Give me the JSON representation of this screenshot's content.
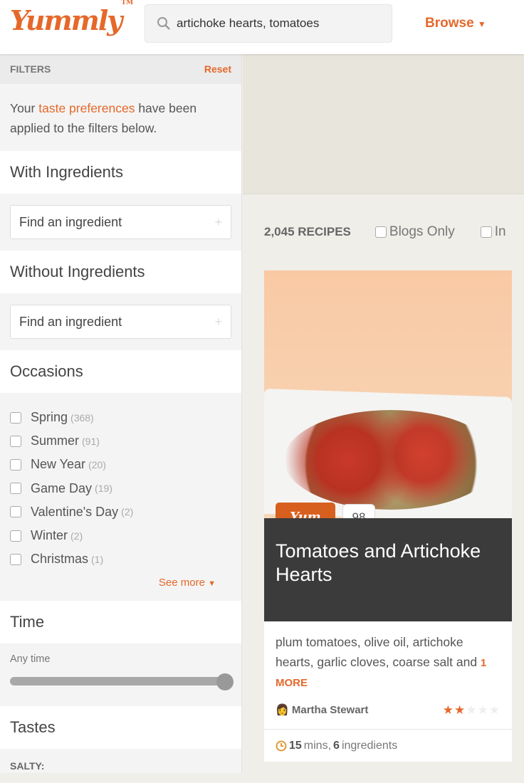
{
  "header": {
    "logo": "Yummly",
    "logo_tm": "TM",
    "search_value": "artichoke hearts, tomatoes",
    "browse": "Browse"
  },
  "sidebar": {
    "filters_label": "FILTERS",
    "reset": "Reset",
    "taste_pre": "Your ",
    "taste_link": "taste preferences",
    "taste_post": " have been applied to the filters below.",
    "with_ingredients": "With Ingredients",
    "with_placeholder": "Find an ingredient",
    "without_ingredients": "Without Ingredients",
    "without_placeholder": "Find an ingredient",
    "occasions": "Occasions",
    "occasion_items": [
      {
        "label": "Spring",
        "count": "(368)"
      },
      {
        "label": "Summer",
        "count": "(91)"
      },
      {
        "label": "New Year",
        "count": "(20)"
      },
      {
        "label": "Game Day",
        "count": "(19)"
      },
      {
        "label": "Valentine's Day",
        "count": "(2)"
      },
      {
        "label": "Winter",
        "count": "(2)"
      },
      {
        "label": "Christmas",
        "count": "(1)"
      }
    ],
    "see_more": "See more",
    "time": "Time",
    "time_value": "Any time",
    "time_slider_percent": 100,
    "tastes": "Tastes",
    "salty": "SALTY:"
  },
  "results": {
    "count": "2,045 RECIPES",
    "blogs_only": "Blogs Only",
    "other_option": "In"
  },
  "card": {
    "yum": "Yum",
    "score": "98",
    "title": "Tomatoes and Artichoke Hearts",
    "ingredients": "plum tomatoes, olive oil, artichoke hearts, garlic cloves, coarse salt and ",
    "more": "1 MORE",
    "source": "Martha Stewart",
    "rating": 2,
    "rating_max": 5,
    "time": "15",
    "time_unit": " mins, ",
    "ingredient_count": "6",
    "ingredient_unit": " ingredients"
  },
  "colors": {
    "accent": "#e5682a",
    "caption_bg": "#3b3b3b"
  }
}
